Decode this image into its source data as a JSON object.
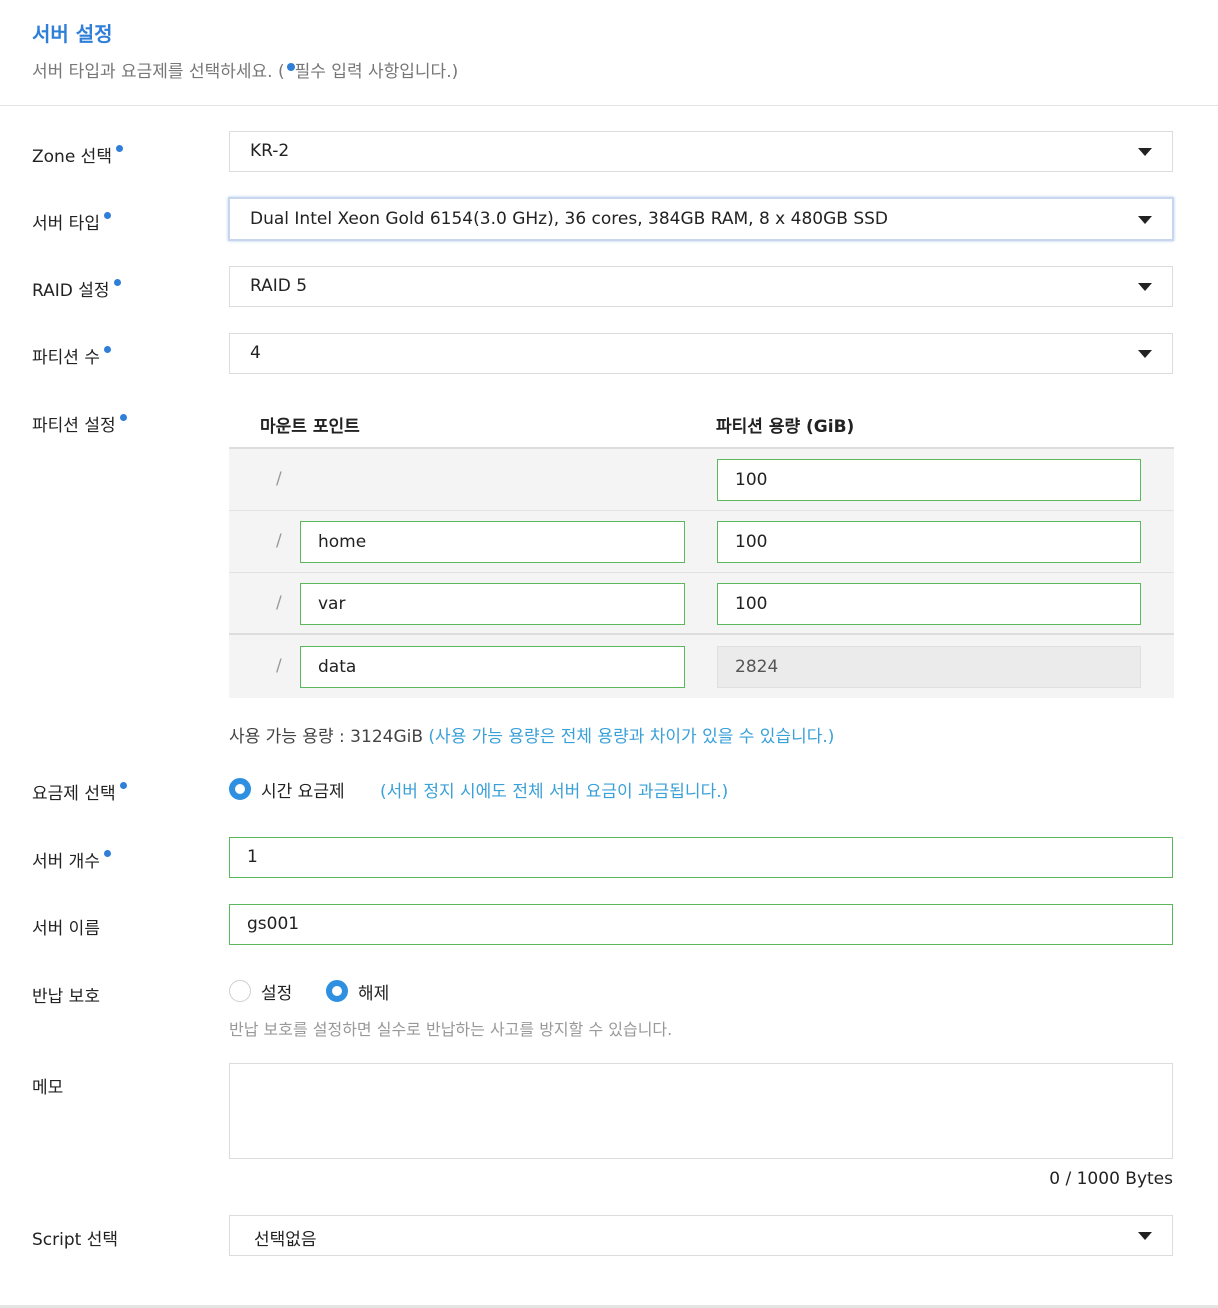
{
  "header": {
    "title": "서버 설정",
    "desc_prefix": "서버 타입과 요금제를 선택하세요. (",
    "desc_suffix": "필수 입력 사항입니다.)"
  },
  "colors": {
    "accent": "#2f7fd8",
    "valid_border": "#5cb85c",
    "note_blue": "#3aa0d8"
  },
  "zone": {
    "label": "Zone 선택",
    "value": "KR-2"
  },
  "server_type": {
    "label": "서버 타입",
    "value": "Dual Intel Xeon Gold 6154(3.0 GHz), 36 cores, 384GB RAM, 8 x 480GB SSD"
  },
  "raid": {
    "label": "RAID 설정",
    "value": "RAID 5"
  },
  "partition_count": {
    "label": "파티션 수",
    "value": "4"
  },
  "partition_settings": {
    "label": "파티션 설정",
    "col_mount": "마운트 포인트",
    "col_size": "파티션 용량 (GiB)",
    "rows": [
      {
        "slash": "/",
        "mount": "",
        "size": "100"
      },
      {
        "slash": "/",
        "mount": "home",
        "size": "100"
      },
      {
        "slash": "/",
        "mount": "var",
        "size": "100"
      },
      {
        "slash": "/",
        "mount": "data",
        "size": "2824"
      }
    ]
  },
  "capacity": {
    "text": "사용 가능 용량 : 3124GiB ",
    "note": "(사용 가능 용량은 전체 용량과 차이가 있을 수 있습니다.)"
  },
  "billing": {
    "label": "요금제 선택",
    "option": "시간 요금제",
    "note": "(서버 정지 시에도 전체 서버 요금이 과금됩니다.)"
  },
  "server_count": {
    "label": "서버 개수",
    "value": "1"
  },
  "server_name": {
    "label": "서버 이름",
    "value": "gs001"
  },
  "return_protection": {
    "label": "반납 보호",
    "option_on": "설정",
    "option_off": "해제",
    "help": "반납 보호를 설정하면 실수로 반납하는 사고를 방지할 수 있습니다."
  },
  "memo": {
    "label": "메모",
    "value": "",
    "byte_count": "0 / 1000 Bytes"
  },
  "script": {
    "label": "Script 선택",
    "value": "선택없음"
  }
}
